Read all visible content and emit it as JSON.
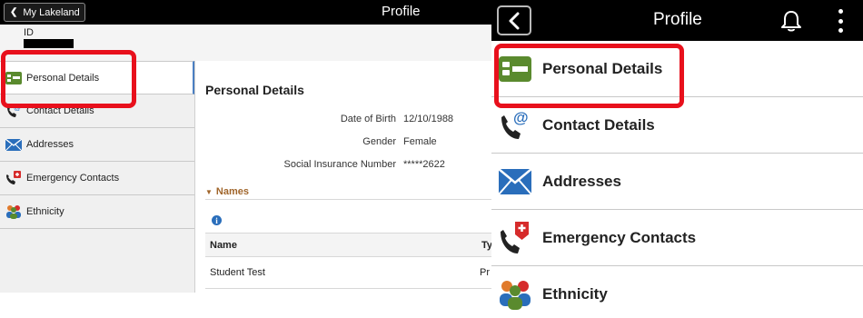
{
  "left": {
    "header": {
      "back_label": "My Lakeland",
      "title": "Profile"
    },
    "id_label": "ID",
    "nav": [
      {
        "label": "Personal Details",
        "icon": "id-card-icon"
      },
      {
        "label": "Contact Details",
        "icon": "phone-at-icon"
      },
      {
        "label": "Addresses",
        "icon": "envelope-icon"
      },
      {
        "label": "Emergency Contacts",
        "icon": "emergency-phone-icon"
      },
      {
        "label": "Ethnicity",
        "icon": "people-icon"
      }
    ],
    "main": {
      "title": "Personal Details",
      "fields": [
        {
          "label": "Date of Birth",
          "value": "12/10/1988"
        },
        {
          "label": "Gender",
          "value": "Female"
        },
        {
          "label": "Social Insurance Number",
          "value": "*****2622"
        }
      ],
      "names_section": "Names",
      "table": {
        "headers": [
          "Name",
          "Ty"
        ],
        "rows": [
          [
            "Student Test",
            "Pr"
          ]
        ]
      }
    }
  },
  "right": {
    "header": {
      "title": "Profile"
    },
    "items": [
      {
        "label": "Personal Details",
        "icon": "id-card-icon"
      },
      {
        "label": "Contact Details",
        "icon": "phone-at-icon"
      },
      {
        "label": "Addresses",
        "icon": "envelope-icon"
      },
      {
        "label": "Emergency Contacts",
        "icon": "emergency-phone-icon"
      },
      {
        "label": "Ethnicity",
        "icon": "people-icon"
      }
    ]
  },
  "colors": {
    "highlight": "#e8101c",
    "id_card_green": "#5a8a2e",
    "envelope_blue": "#2a6ebb",
    "names_orange": "#a0652b"
  }
}
